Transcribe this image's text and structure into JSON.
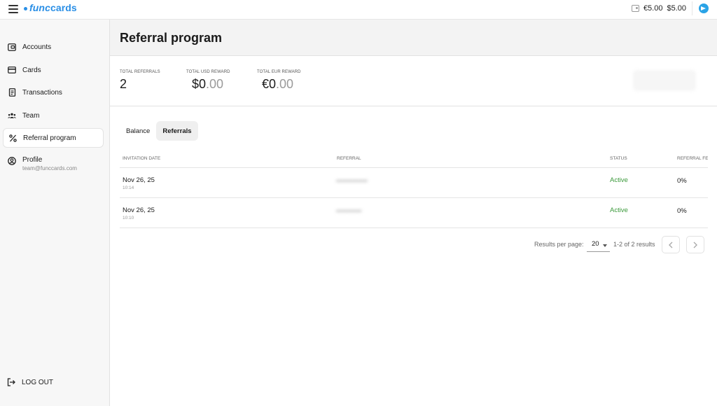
{
  "header": {
    "logo_func": "func",
    "logo_cards": "cards",
    "eur_balance": "€5.00",
    "usd_balance": "$5.00"
  },
  "sidebar": {
    "items": [
      {
        "label": "Accounts",
        "icon": "wallet-icon"
      },
      {
        "label": "Cards",
        "icon": "card-icon"
      },
      {
        "label": "Transactions",
        "icon": "receipt-icon"
      },
      {
        "label": "Team",
        "icon": "team-icon"
      },
      {
        "label": "Referral program",
        "icon": "percent-icon",
        "active": true
      }
    ],
    "profile": {
      "label": "Profile",
      "email": "team@funccards.com"
    },
    "logout": "LOG OUT"
  },
  "page": {
    "title": "Referral program"
  },
  "stats": {
    "total_referrals_label": "TOTAL REFERRALS",
    "total_referrals_value": "2",
    "usd_label": "TOTAL USD REWARD",
    "usd_value_main": "$0",
    "usd_value_dec": ".00",
    "eur_label": "TOTAL EUR REWARD",
    "eur_value_main": "€0",
    "eur_value_dec": ".00"
  },
  "tabs": [
    {
      "label": "Balance"
    },
    {
      "label": "Referrals",
      "active": true
    }
  ],
  "table": {
    "columns": [
      "INVITATION DATE",
      "REFERRAL",
      "STATUS",
      "REFERRAL FEE"
    ],
    "rows": [
      {
        "date": "Nov 26, 25",
        "time": "10:14",
        "referral": "••••••••••••••••",
        "status": "Active",
        "fee": "0%"
      },
      {
        "date": "Nov 26, 25",
        "time": "10:10",
        "referral": "•••••••••••••",
        "status": "Active",
        "fee": "0%"
      }
    ]
  },
  "pagination": {
    "rpp_label": "Results per page:",
    "rpp_value": "20",
    "range": "1-2 of 2 results"
  },
  "colors": {
    "accent": "#2a8fe6",
    "active_status": "#3c9a3c"
  }
}
